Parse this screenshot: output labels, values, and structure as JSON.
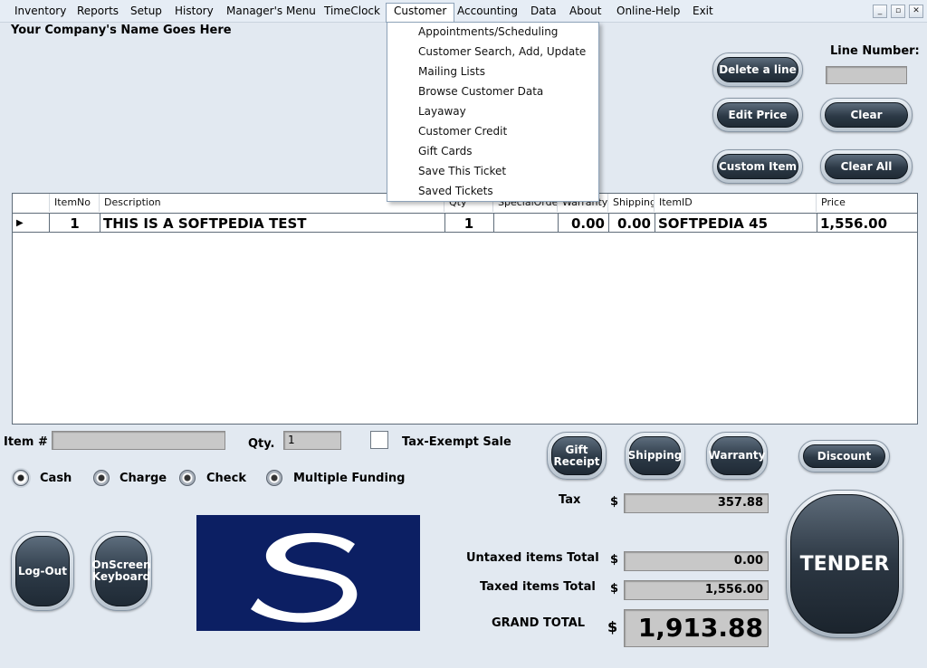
{
  "menubar": {
    "items": [
      "Inventory",
      "Reports",
      "Setup",
      "History",
      "Manager's Menu",
      "TimeClock",
      "Customer",
      "Accounting",
      "Data",
      "About",
      "Online-Help",
      "Exit"
    ],
    "active": "Customer"
  },
  "window_controls": {
    "minimize": "_",
    "restore": "▫",
    "close": "✕"
  },
  "company_name": "Your Company's Name Goes Here",
  "customer_menu": {
    "items": [
      "Appointments/Scheduling",
      "Customer Search, Add, Update",
      "Mailing Lists",
      "Browse Customer Data",
      "Layaway",
      "Customer Credit",
      "Gift Cards",
      "Save This Ticket",
      "Saved Tickets"
    ]
  },
  "line_number": {
    "label": "Line Number:",
    "value": ""
  },
  "buttons": {
    "delete_line": "Delete a line",
    "edit_price": "Edit Price",
    "clear": "Clear",
    "custom_item": "Custom Item",
    "clear_all": "Clear All",
    "gift_receipt": "Gift Receipt",
    "shipping": "Shipping",
    "warranty": "Warranty",
    "discount": "Discount",
    "log_out": "Log-Out",
    "onscreen_keyboard": "OnScreen Keyboard",
    "tender": "TENDER"
  },
  "grid": {
    "columns": [
      "ItemNo",
      "Description",
      "Qty",
      "SpecialOrder",
      "Warranty",
      "Shipping",
      "ItemID",
      "Price"
    ],
    "rows": [
      {
        "itemno": "1",
        "description": "THIS IS A SOFTPEDIA TEST",
        "qty": "1",
        "special_order": "",
        "warranty": "0.00",
        "shipping": "0.00",
        "itemid": "SOFTPEDIA 45",
        "price": "1,556.00"
      }
    ]
  },
  "entry": {
    "item_label": "Item #",
    "item_value": "",
    "qty_label": "Qty.",
    "qty_value": "1",
    "tax_exempt_label": "Tax-Exempt Sale"
  },
  "payment": {
    "options": [
      "Cash",
      "Charge",
      "Check",
      "Multiple Funding"
    ],
    "selected": "Cash"
  },
  "totals": {
    "currency": "$",
    "tax_label": "Tax",
    "tax": "357.88",
    "untaxed_label": "Untaxed items Total",
    "untaxed": "0.00",
    "taxed_label": "Taxed items Total",
    "taxed": "1,556.00",
    "grand_label": "GRAND TOTAL",
    "grand": "1,913.88"
  },
  "logo": {
    "letter": "S",
    "background": "#0c1f63"
  }
}
